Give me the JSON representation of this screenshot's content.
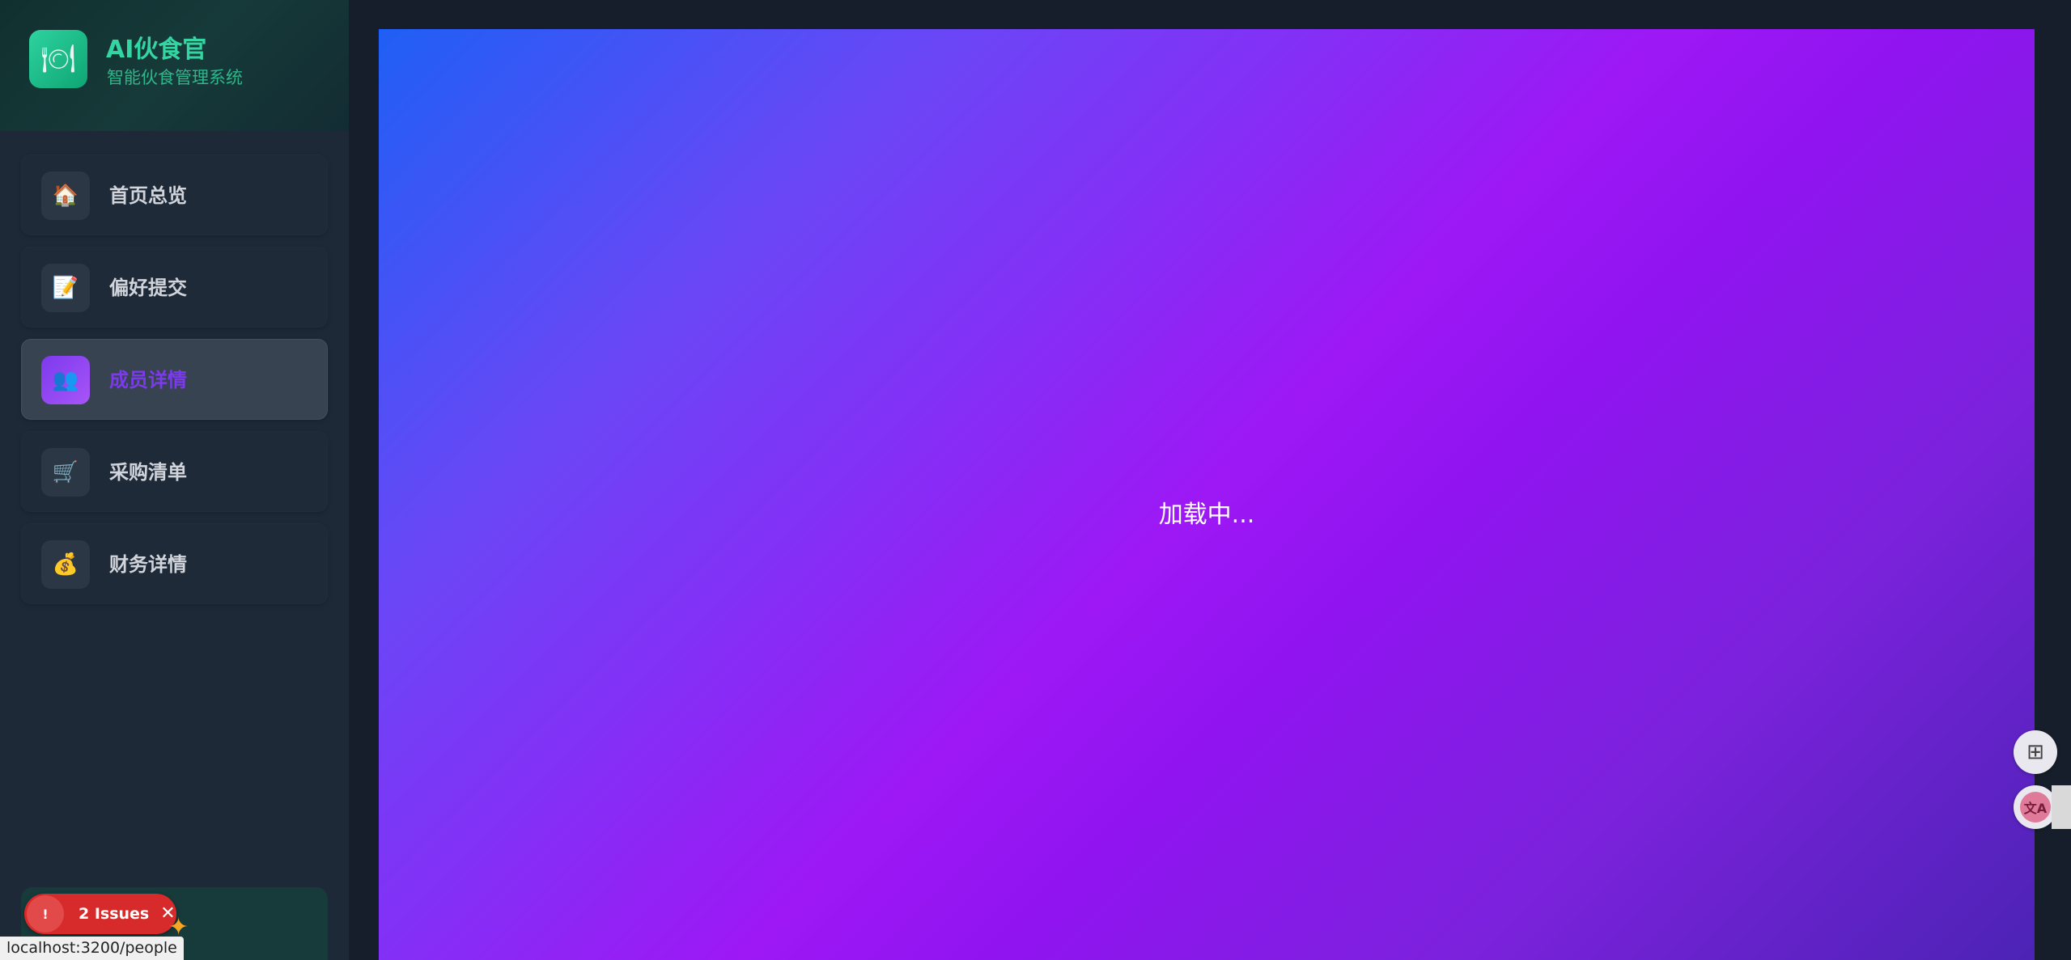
{
  "brand": {
    "title": "AI伙食官",
    "subtitle": "智能伙食管理系统",
    "logo_icon": "plate-icon"
  },
  "nav": {
    "items": [
      {
        "label": "首页总览",
        "icon": "house-icon",
        "glyph": "🏠"
      },
      {
        "label": "偏好提交",
        "icon": "memo-icon",
        "glyph": "📝"
      },
      {
        "label": "成员详情",
        "icon": "people-icon",
        "glyph": "👥",
        "active": true
      },
      {
        "label": "采购清单",
        "icon": "cart-icon",
        "glyph": "🛒"
      },
      {
        "label": "财务详情",
        "icon": "money-bag-icon",
        "glyph": "💰"
      }
    ]
  },
  "main": {
    "loading_text": "加载中..."
  },
  "dev_overlay": {
    "issues_label": "2 Issues",
    "issues_dot": "!",
    "close_glyph": "✕"
  },
  "status_bar": {
    "url": "localhost:3200/people"
  },
  "colors": {
    "brand_accent": "#33d6a3",
    "active_nav": "#7c3aed",
    "issues_red": "#d72a2a"
  }
}
